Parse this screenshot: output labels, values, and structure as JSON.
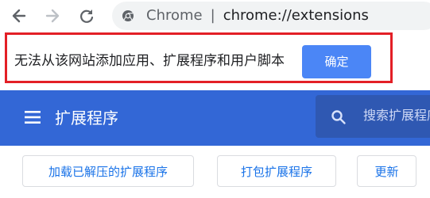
{
  "browser": {
    "back_icon": "arrow-left-icon",
    "forward_icon": "arrow-right-icon",
    "reload_icon": "reload-icon",
    "site_icon": "chrome-site-icon",
    "omnibox_label": "Chrome",
    "separator": "|",
    "url": "chrome://extensions"
  },
  "notice": {
    "message": "无法从该网站添加应用、扩展程序和用户脚本",
    "ok_label": "确定",
    "highlight_color": "#e31f26",
    "button_color": "#4b86f6"
  },
  "header": {
    "menu_icon": "menu-icon",
    "title": "扩展程序",
    "search_icon": "search-icon",
    "search_placeholder": "搜索扩展程序",
    "background_color": "#3367d6"
  },
  "actions": {
    "load_unpacked": "加载已解压的扩展程序",
    "pack": "打包扩展程序",
    "update": "更新",
    "button_text_color": "#1a73e8"
  }
}
